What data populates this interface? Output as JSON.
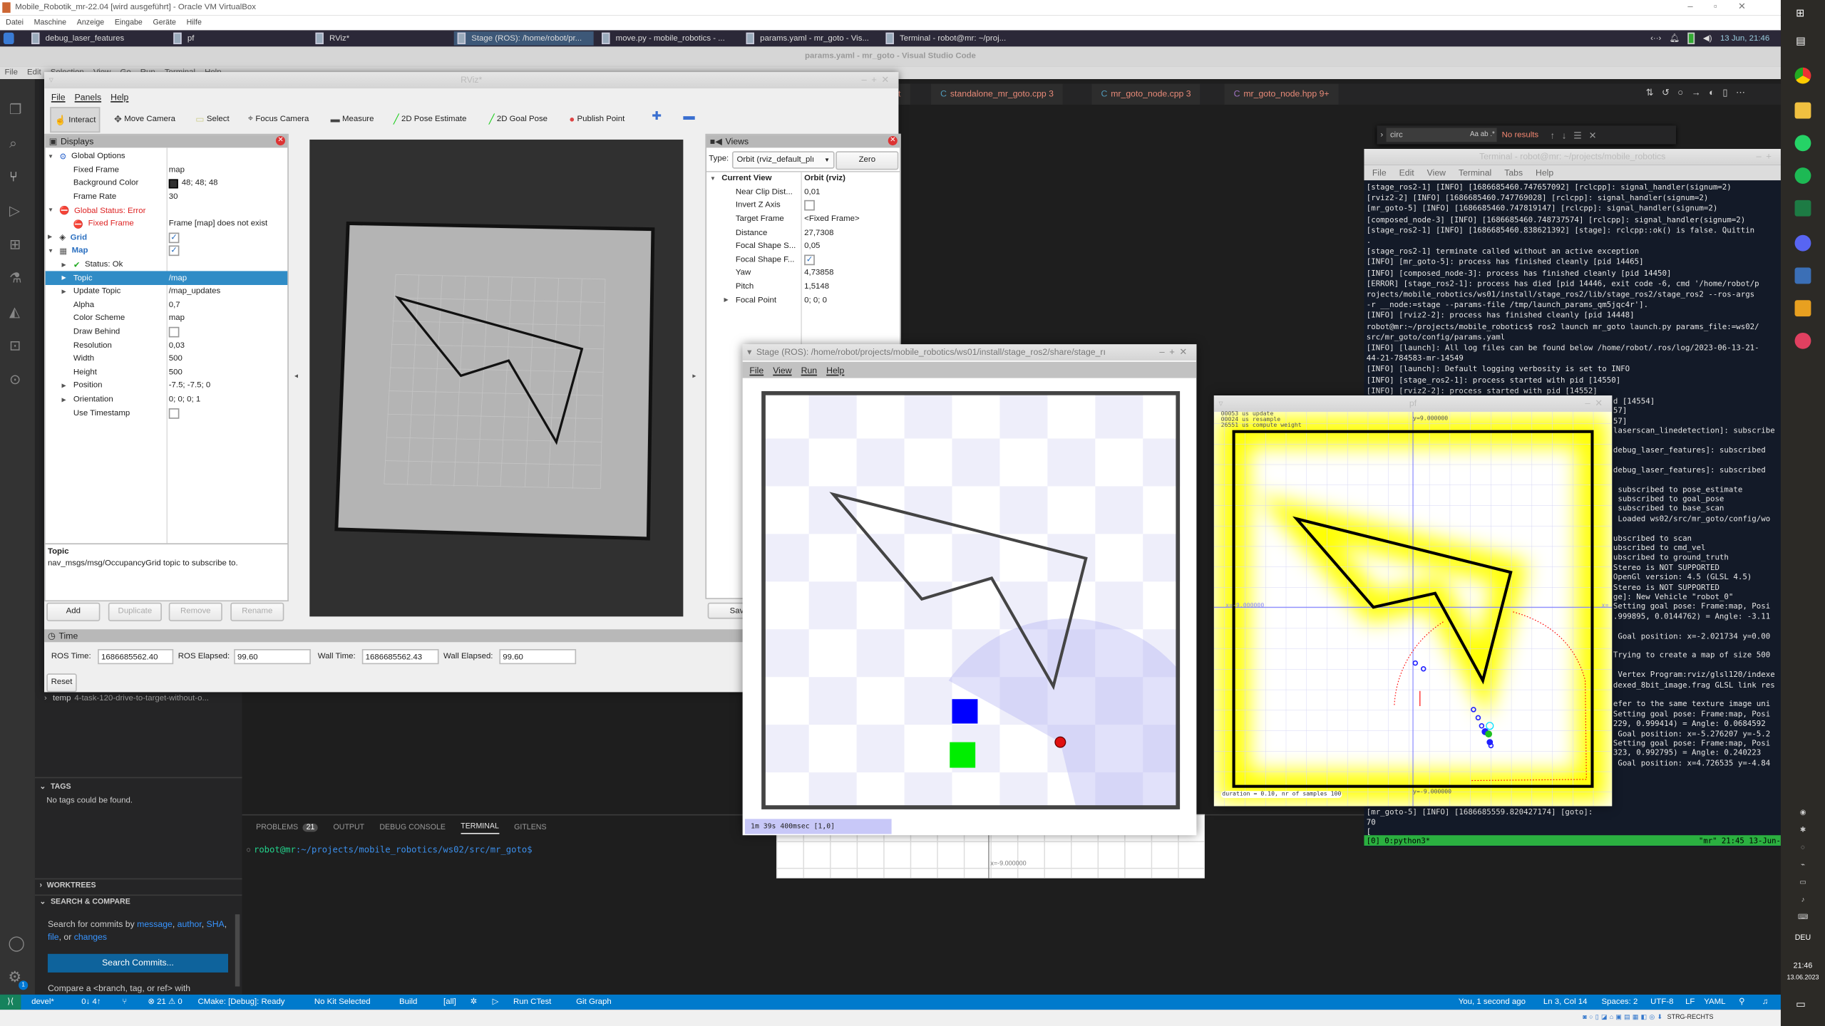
{
  "vbox": {
    "title": "Mobile_Robotik_mr-22.04 [wird ausgeführt] - Oracle VM VirtualBox",
    "menu": [
      "Datei",
      "Maschine",
      "Anzeige",
      "Eingabe",
      "Geräte",
      "Hilfe"
    ]
  },
  "guest_taskbar": {
    "items": [
      {
        "label": "debug_laser_features"
      },
      {
        "label": "pf"
      },
      {
        "label": "RViz*"
      },
      {
        "label": "Stage (ROS): /home/robot/pr...",
        "active": true
      },
      {
        "label": "move.py - mobile_robotics - ..."
      },
      {
        "label": "params.yaml - mr_goto - Vis..."
      },
      {
        "label": "Terminal - robot@mr: ~/proj..."
      }
    ],
    "clock": "13 Jun, 21:46"
  },
  "vscode": {
    "title": "params.yaml - mr_goto - Visual Studio Code",
    "menu": [
      "File",
      "Edit",
      "Selection",
      "View",
      "Go",
      "Run",
      "Terminal",
      "Help"
    ],
    "tabs": [
      {
        "label": "xt"
      },
      {
        "label": "standalone_mr_goto.cpp 3"
      },
      {
        "label": "mr_goto_node.cpp 3"
      },
      {
        "label": "mr_goto_node.hpp 9+"
      }
    ],
    "find": {
      "value": "circ",
      "result": "No results"
    },
    "sidebar": {
      "branch_name": "temp",
      "branch_desc": "4-task-120-drive-to-target-without-o...",
      "tags_header": "TAGS",
      "tags_empty": "No tags could be found.",
      "worktrees_header": "WORKTREES",
      "search_header": "SEARCH & COMPARE",
      "search_text": "Search for commits by",
      "search_links": [
        "message",
        "author",
        "SHA",
        "file",
        "changes"
      ],
      "search_or": "or",
      "search_button": "Search Commits...",
      "compare_text": "Compare a <branch, tag, or ref> with"
    },
    "panel": {
      "tabs": [
        "PROBLEMS",
        "OUTPUT",
        "DEBUG CONSOLE",
        "TERMINAL",
        "GITLENS"
      ],
      "active_tab": "TERMINAL",
      "problems_count": "21",
      "prompt_user": "robot@mr",
      "prompt_path": ":~/projects/mobile_robotics/ws02/src/mr_goto$"
    },
    "status_left": [
      "devel*",
      "0↓ 4↑",
      "⊗ 21 ⚠ 0",
      "CMake: [Debug]: Ready",
      "No Kit Selected",
      "Build",
      "[all]",
      "Run CTest",
      "Git Graph"
    ],
    "status_right": [
      "You, 1 second ago",
      "Ln 3, Col 14",
      "Spaces: 2",
      "UTF-8",
      "LF",
      "YAML"
    ],
    "settings_badge": "1"
  },
  "rviz": {
    "title": "RViz*",
    "menu": [
      "File",
      "Panels",
      "Help"
    ],
    "toolbar": [
      {
        "label": "Interact",
        "icon": "hand-icon"
      },
      {
        "label": "Move Camera",
        "icon": "move-icon"
      },
      {
        "label": "Select",
        "icon": "select-icon"
      },
      {
        "label": "Focus Camera",
        "icon": "focus-icon"
      },
      {
        "label": "Measure",
        "icon": "ruler-icon"
      },
      {
        "label": "2D Pose Estimate",
        "icon": "arrow-green-icon"
      },
      {
        "label": "2D Goal Pose",
        "icon": "arrow-green-icon"
      },
      {
        "label": "Publish Point",
        "icon": "pin-icon"
      }
    ],
    "displays": {
      "title": "Displays",
      "rows": [
        {
          "label": "Global Options",
          "value": "",
          "level": 0,
          "exp": "open",
          "icon": "gear-icon"
        },
        {
          "label": "Fixed Frame",
          "value": "map",
          "level": 1
        },
        {
          "label": "Background Color",
          "value": "48; 48; 48",
          "level": 1,
          "swatch": "#303030"
        },
        {
          "label": "Frame Rate",
          "value": "30",
          "level": 1
        },
        {
          "label": "Global Status: Error",
          "value": "",
          "level": 0,
          "exp": "open",
          "icon": "error-icon",
          "style": "error"
        },
        {
          "label": "Fixed Frame",
          "value": "Frame [map] does not exist",
          "level": 1,
          "icon": "error-icon",
          "style": "error"
        },
        {
          "label": "Grid",
          "value": "",
          "level": 0,
          "exp": "closed",
          "icon": "grid-icon",
          "style": "link",
          "checked": true
        },
        {
          "label": "Map",
          "value": "",
          "level": 0,
          "exp": "open",
          "icon": "map-icon",
          "style": "link",
          "checked": true
        },
        {
          "label": "Status: Ok",
          "value": "",
          "level": 1,
          "exp": "closed",
          "icon": "check-icon"
        },
        {
          "label": "Topic",
          "value": "/map",
          "level": 1,
          "exp": "closed",
          "selected": true
        },
        {
          "label": "Update Topic",
          "value": "/map_updates",
          "level": 1,
          "exp": "closed"
        },
        {
          "label": "Alpha",
          "value": "0,7",
          "level": 1
        },
        {
          "label": "Color Scheme",
          "value": "map",
          "level": 1
        },
        {
          "label": "Draw Behind",
          "value": "",
          "level": 1,
          "checked": false
        },
        {
          "label": "Resolution",
          "value": "0,03",
          "level": 1
        },
        {
          "label": "Width",
          "value": "500",
          "level": 1
        },
        {
          "label": "Height",
          "value": "500",
          "level": 1
        },
        {
          "label": "Position",
          "value": "-7.5; -7.5; 0",
          "level": 1,
          "exp": "closed"
        },
        {
          "label": "Orientation",
          "value": "0; 0; 0; 1",
          "level": 1,
          "exp": "closed"
        },
        {
          "label": "Use Timestamp",
          "value": "",
          "level": 1,
          "checked": false
        }
      ],
      "desc_title": "Topic",
      "desc_text": "nav_msgs/msg/OccupancyGrid topic to subscribe to.",
      "buttons": [
        {
          "label": "Add",
          "enabled": true
        },
        {
          "label": "Duplicate",
          "enabled": false
        },
        {
          "label": "Remove",
          "enabled": false
        },
        {
          "label": "Rename",
          "enabled": false
        }
      ]
    },
    "views": {
      "title": "Views",
      "type_label": "Type:",
      "type_value": "Orbit (rviz_default_plı",
      "zero": "Zero",
      "save": "Sav",
      "rows": [
        {
          "label": "Current View",
          "value": "Orbit (rviz)",
          "level": 0,
          "exp": "open",
          "bold": true
        },
        {
          "label": "Near Clip Dist...",
          "value": "0,01",
          "level": 1
        },
        {
          "label": "Invert Z Axis",
          "value": "",
          "level": 1,
          "checked": false
        },
        {
          "label": "Target Frame",
          "value": "<Fixed Frame>",
          "level": 1
        },
        {
          "label": "Distance",
          "value": "27,7308",
          "level": 1
        },
        {
          "label": "Focal Shape S...",
          "value": "0,05",
          "level": 1
        },
        {
          "label": "Focal Shape F...",
          "value": "",
          "level": 1,
          "checked": true
        },
        {
          "label": "Yaw",
          "value": "4,73858",
          "level": 1
        },
        {
          "label": "Pitch",
          "value": "1,5148",
          "level": 1
        },
        {
          "label": "Focal Point",
          "value": "0; 0; 0",
          "level": 1,
          "exp": "closed"
        }
      ]
    },
    "time": {
      "title": "Time",
      "ros_time_label": "ROS Time:",
      "ros_time": "1686685562.40",
      "ros_elapsed_label": "ROS Elapsed:",
      "ros_elapsed": "99.60",
      "wall_time_label": "Wall Time:",
      "wall_time": "1686685562.43",
      "wall_elapsed_label": "Wall Elapsed:",
      "wall_elapsed": "99.60",
      "reset": "Reset"
    }
  },
  "stage": {
    "title": "Stage (ROS): /home/robot/projects/mobile_robotics/ws01/install/stage_ros2/share/stage_rı",
    "menu": [
      "File",
      "View",
      "Run",
      "Help"
    ],
    "status": "1m 39s 400msec [1,0]",
    "behind_label": "x=-9.000000"
  },
  "pf": {
    "title": "pf",
    "stats": [
      "00053 us update",
      "00024 us resample",
      "26551 us compute weight"
    ],
    "y_top": "y=9.000000",
    "x_left": "x=-9.000000",
    "x_right": "x=",
    "y_bottom": "y=-9.000000",
    "footer": "duration = 0.10, nr of samples 100",
    "colors": {
      "wall": "#000000",
      "glow": "#ffff00",
      "particles": "#2020ff",
      "robot": "#20c020",
      "laser": "#ff0000"
    }
  },
  "terminal": {
    "title": "Terminal - robot@mr: ~/projects/mobile_robotics",
    "menu": [
      "File",
      "Edit",
      "View",
      "Terminal",
      "Tabs",
      "Help"
    ],
    "lines": [
      "[stage_ros2-1] [INFO] [1686685460.747657092] [rclcpp]: signal_handler(signum=2)",
      "[rviz2-2] [INFO] [1686685460.747769028] [rclcpp]: signal_handler(signum=2)",
      "[mr_goto-5] [INFO] [1686685460.747819147] [rclcpp]: signal_handler(signum=2)",
      "[composed_node-3] [INFO] [1686685460.748737574] [rclcpp]: signal_handler(signum=2)",
      "[stage_ros2-1] [INFO] [1686685460.838621392] [stage]: rclcpp::ok() is false. Quittin",
      ".",
      "[stage_ros2-1] terminate called without an active exception",
      "[INFO] [mr_goto-5]: process has finished cleanly [pid 14465]",
      "[INFO] [composed_node-3]: process has finished cleanly [pid 14450]",
      "[ERROR] [stage_ros2-1]: process has died [pid 14446, exit code -6, cmd '/home/robot/p",
      "rojects/mobile_robotics/ws01/install/stage_ros2/lib/stage_ros2/stage_ros2 --ros-args",
      "-r __node:=stage --params-file /tmp/launch_params_qm5jqc4r'].",
      "[INFO] [rviz2-2]: process has finished cleanly [pid 14448]",
      "robot@mr:~/projects/mobile_robotics$ ros2 launch mr_goto launch.py params_file:=ws02/",
      "src/mr_goto/config/params.yaml",
      "[INFO] [launch]: All log files can be found below /home/robot/.ros/log/2023-06-13-21-",
      "44-21-784583-mr-14549",
      "[INFO] [launch]: Default logging verbosity is set to INFO",
      "[INFO] [stage_ros2-1]: process started with pid [14550]",
      "[INFO] [rviz2-2]: process started with pid [14552]"
    ],
    "tail_lines": [
      "d [14554]",
      "57]",
      "57]",
      "laserscan_linedetection]: subscribe",
      "",
      "debug_laser_features]: subscribed",
      "",
      "debug_laser_features]: subscribed",
      "",
      " subscribed to pose_estimate",
      " subscribed to goal_pose",
      " subscribed to base_scan",
      " Loaded ws02/src/mr_goto/config/wo",
      "",
      "ubscribed to scan",
      "ubscribed to cmd_vel",
      "ubscribed to ground_truth",
      "Stereo is NOT SUPPORTED",
      "OpenGl version: 4.5 (GLSL 4.5)",
      "Stereo is NOT SUPPORTED",
      "ge]: New Vehicle \"robot_0\"",
      "Setting goal pose: Frame:map, Posi",
      ".999895, 0.0144762) = Angle: -3.11",
      "",
      " Goal position: x=-2.021734 y=0.00",
      "",
      "Trying to create a map of size 500",
      "",
      " Vertex Program:rviz/glsl120/indexe",
      "dexed_8bit_image.frag GLSL link res",
      "",
      "efer to the same texture image uni",
      "Setting goal pose: Frame:map, Posi",
      "229, 0.999414) = Angle: 0.0684592",
      " Goal position: x=-5.276207 y=-5.2",
      "Setting goal pose: Frame:map, Posi",
      "323, 0.992795) = Angle: 0.240223",
      " Goal position: x=4.726535 y=-4.84"
    ],
    "bottom_lines": [
      "[mr_goto-5] [INFO] [1686685559.820427174] [goto]:",
      "70",
      "["
    ],
    "status_left": "[0] 0:python3*",
    "status_right": "\"mr\" 21:45 13-Jun-"
  },
  "windows": {
    "lang": "DEU",
    "time": "21:46",
    "date": "13.06.2023",
    "host_key": "STRG-RECHTS"
  }
}
